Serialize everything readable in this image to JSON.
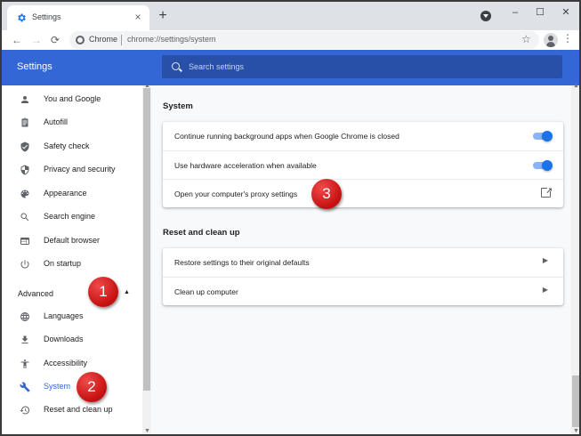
{
  "tab": {
    "title": "Settings",
    "close": "×"
  },
  "newtab": "+",
  "window": {
    "minimize": "–",
    "maximize": "☐",
    "close": "✕"
  },
  "toolbar": {
    "back": "←",
    "forward": "→",
    "reload": "⟳",
    "scheme": "Chrome",
    "url": "chrome://settings/system",
    "star": "☆",
    "menu": "⋮"
  },
  "header": {
    "title": "Settings",
    "search_placeholder": "Search settings"
  },
  "sidebar": {
    "items": [
      {
        "label": "You and Google",
        "icon": "person-icon"
      },
      {
        "label": "Autofill",
        "icon": "clipboard-icon"
      },
      {
        "label": "Safety check",
        "icon": "shield-check-icon"
      },
      {
        "label": "Privacy and security",
        "icon": "shield-icon"
      },
      {
        "label": "Appearance",
        "icon": "palette-icon"
      },
      {
        "label": "Search engine",
        "icon": "search-icon"
      },
      {
        "label": "Default browser",
        "icon": "browser-icon"
      },
      {
        "label": "On startup",
        "icon": "power-icon"
      }
    ],
    "advanced_label": "Advanced",
    "advanced_items": [
      {
        "label": "Languages",
        "icon": "globe-icon"
      },
      {
        "label": "Downloads",
        "icon": "download-icon"
      },
      {
        "label": "Accessibility",
        "icon": "accessibility-icon"
      },
      {
        "label": "System",
        "icon": "wrench-icon",
        "active": true
      },
      {
        "label": "Reset and clean up",
        "icon": "restore-icon"
      }
    ]
  },
  "system": {
    "title": "System",
    "rows": [
      {
        "label": "Continue running background apps when Google Chrome is closed",
        "toggle": true
      },
      {
        "label": "Use hardware acceleration when available",
        "toggle": true
      },
      {
        "label": "Open your computer's proxy settings",
        "external": true
      }
    ]
  },
  "reset": {
    "title": "Reset and clean up",
    "rows": [
      {
        "label": "Restore settings to their original defaults"
      },
      {
        "label": "Clean up computer"
      }
    ]
  },
  "callouts": [
    "1",
    "2",
    "3"
  ],
  "colors": {
    "accent": "#3367d6",
    "callout": "#d91a1a",
    "toggle": "#1a73e8"
  }
}
